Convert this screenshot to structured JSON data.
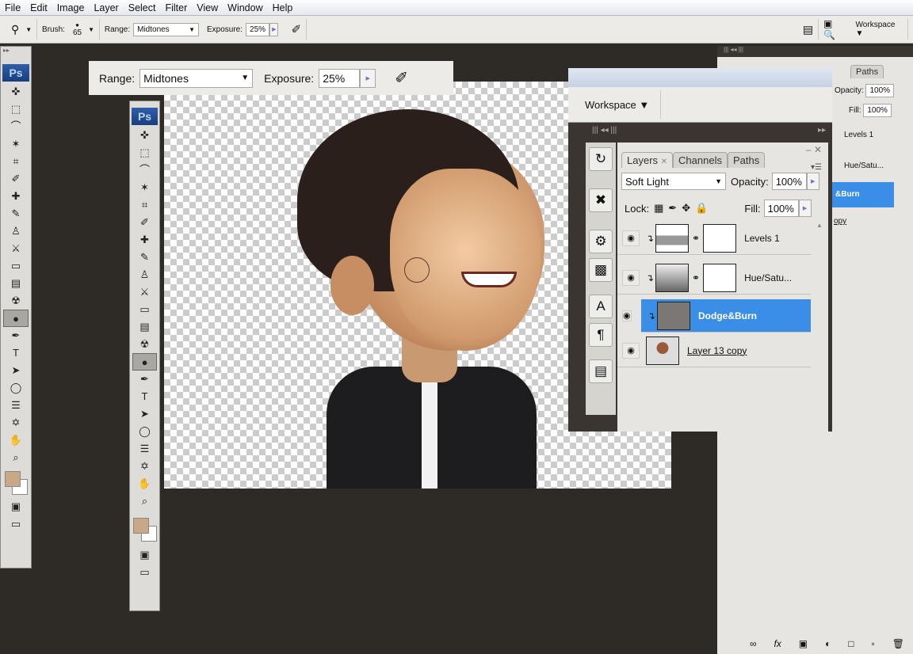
{
  "menu": [
    "File",
    "Edit",
    "Image",
    "Layer",
    "Select",
    "Filter",
    "View",
    "Window",
    "Help"
  ],
  "options": {
    "brush_label": "Brush:",
    "brush_size": "65",
    "range_label": "Range:",
    "range_value": "Midtones",
    "exposure_label": "Exposure:",
    "exposure_value": "25%",
    "workspace": "Workspace ▼"
  },
  "toolbox": {
    "logo": "Ps",
    "tools": [
      "✜",
      "⬚",
      "⌒",
      "✶",
      "⌗",
      "✐",
      "✚",
      "✎",
      "♙",
      "⚔",
      "▭",
      "▤",
      "☢",
      "●",
      "✒",
      "T",
      "➤",
      "◯",
      "☰",
      "✡",
      "✋",
      "⌕"
    ],
    "selected_index": 13,
    "foreground_color": "#c9a887",
    "background_color": "#ffffff"
  },
  "layers_panel": {
    "tabs": [
      "Layers",
      "Channels",
      "Paths"
    ],
    "blend_mode": "Soft Light",
    "opacity_label": "Opacity:",
    "opacity": "100%",
    "lock_label": "Lock:",
    "fill_label": "Fill:",
    "fill": "100%",
    "layers": [
      {
        "name": "Levels 1",
        "selected": false
      },
      {
        "name": "Hue/Satu...",
        "selected": false
      },
      {
        "name": "Dodge&Burn",
        "selected": true
      },
      {
        "name": "Layer 13 copy",
        "selected": false
      }
    ],
    "selected_color": "#3a8ee6"
  },
  "right_panel": {
    "opacity": "100%",
    "fill": "100%",
    "layers": [
      "Levels 1",
      "Hue/Satu...",
      "&Burn",
      "opy"
    ],
    "bottom_icons": [
      "link-icon",
      "fx-icon",
      "mask-icon",
      "adjustment-icon",
      "folder-icon",
      "new-layer-icon",
      "trash-icon"
    ]
  }
}
